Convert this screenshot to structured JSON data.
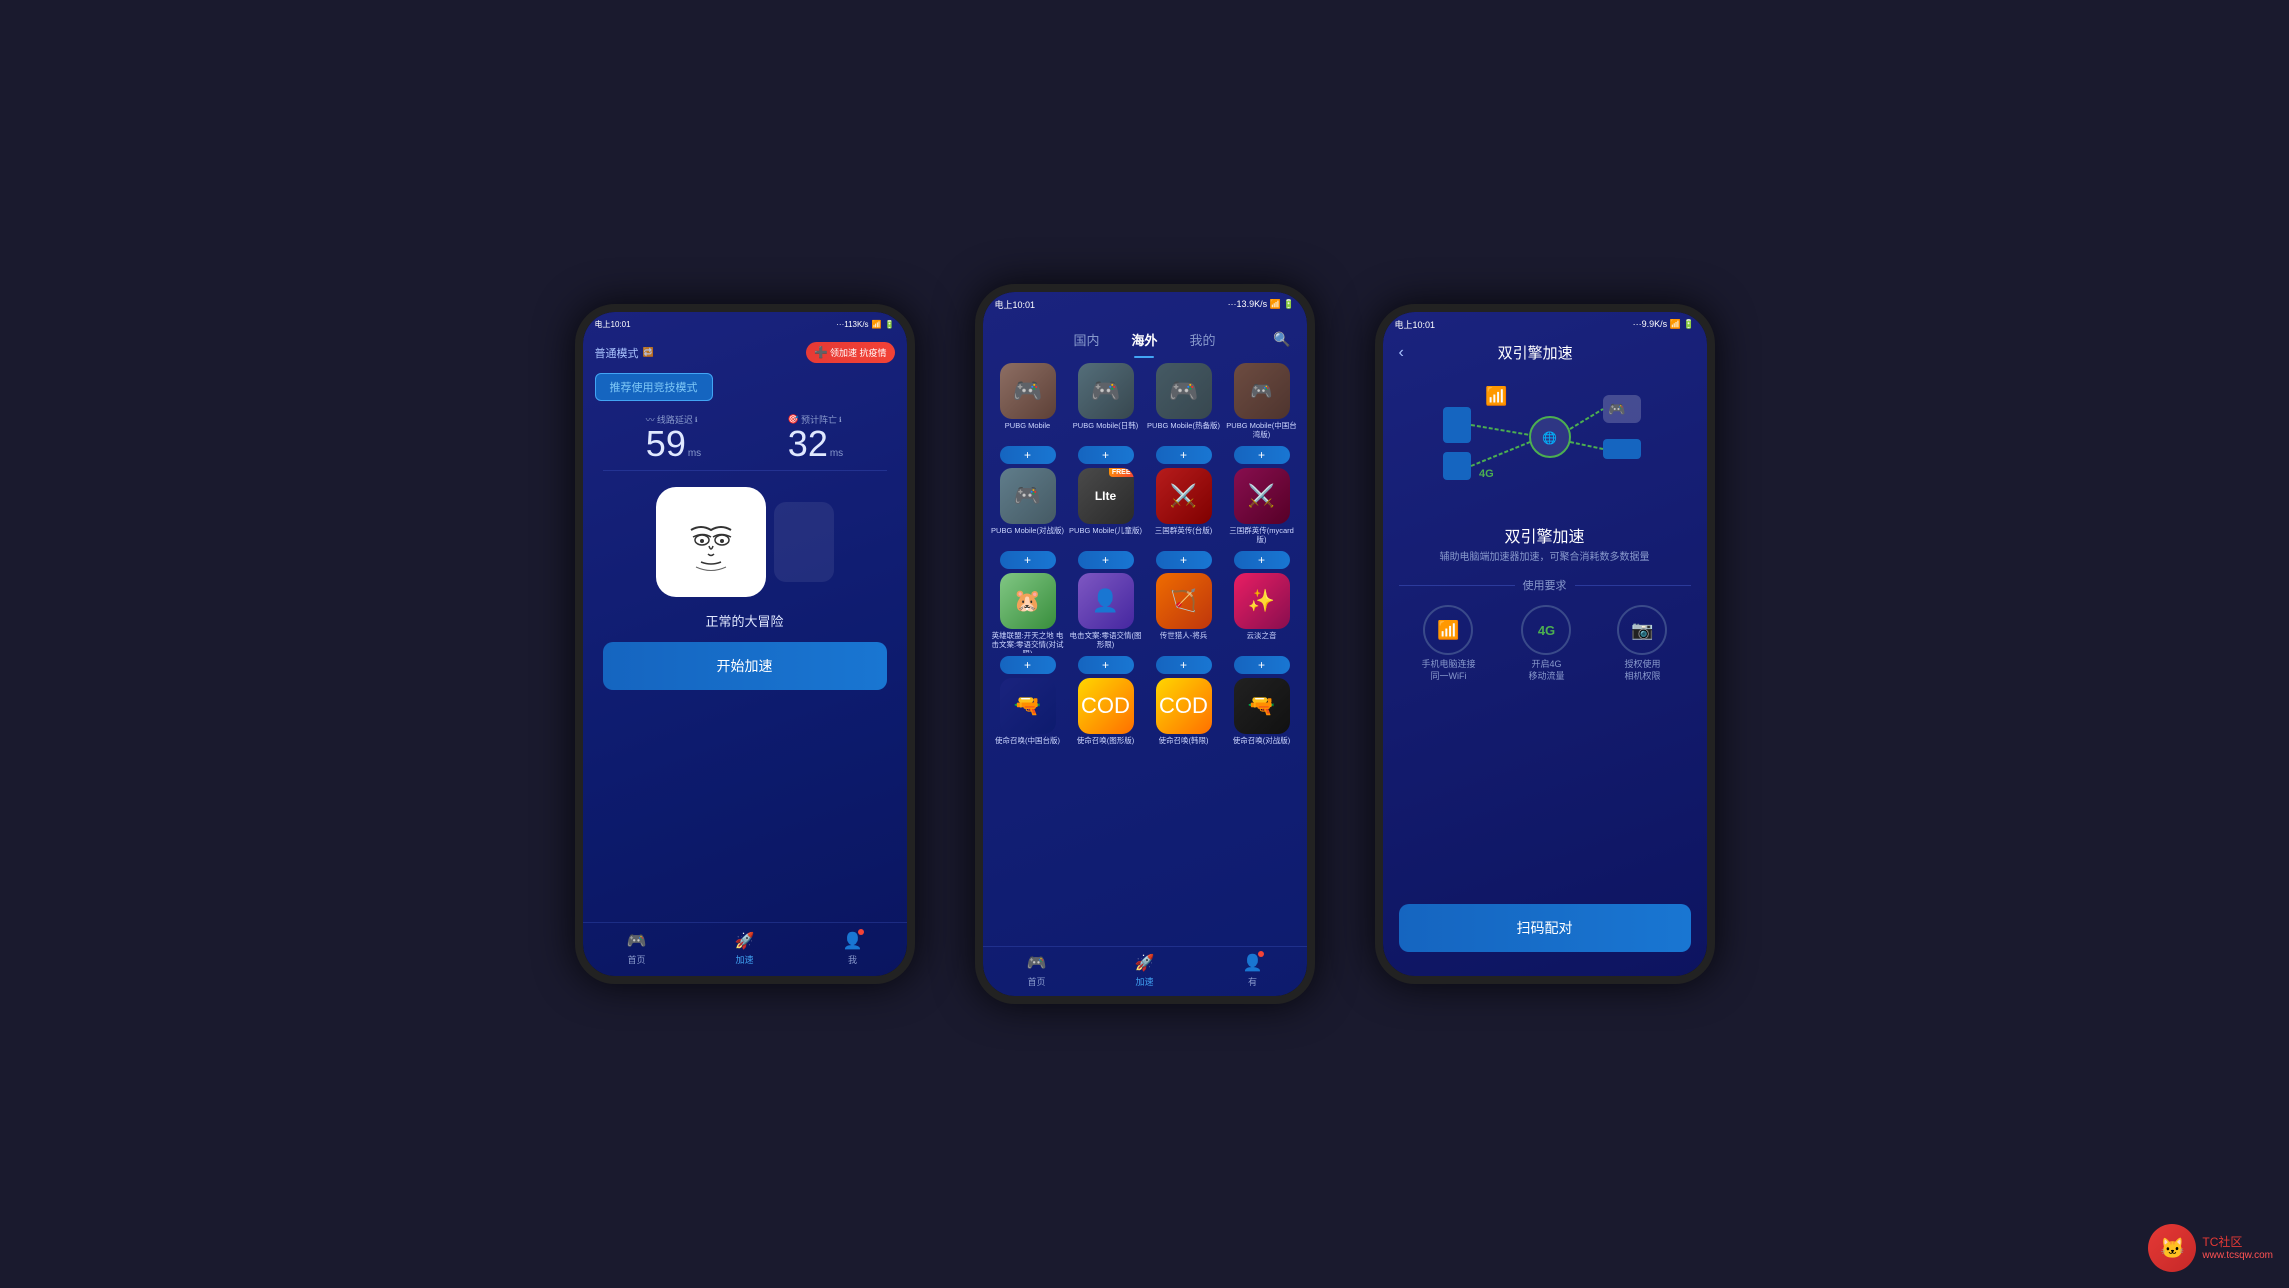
{
  "background_color": "#1a1a2e",
  "phones": [
    {
      "id": "phone1",
      "status_bar": {
        "left": "电上10:01",
        "right": "113K/s 🔋 WiFi"
      },
      "header": {
        "mode_label": "普通模式",
        "antivirus_btn": "领加速 抗疫情"
      },
      "recommend_btn": "推荐使用竞技模式",
      "stats": [
        {
          "label": "线路延迟",
          "value": "59",
          "unit": "ms"
        },
        {
          "label": "预计阵亡",
          "value": "32",
          "unit": "ms"
        }
      ],
      "game_name": "正常的大冒险",
      "start_btn": "开始加速",
      "nav": [
        {
          "label": "首页",
          "active": false
        },
        {
          "label": "加速",
          "active": true
        },
        {
          "label": "我",
          "active": false,
          "badge": true
        }
      ]
    },
    {
      "id": "phone2",
      "status_bar": {
        "left": "电上10:01",
        "right": "13.9K/s WiFi"
      },
      "tabs": [
        {
          "label": "国内",
          "active": false
        },
        {
          "label": "海外",
          "active": true
        },
        {
          "label": "我的",
          "active": false
        }
      ],
      "games": [
        [
          {
            "name": "PUBG Mobile",
            "color": "gt-pubg1",
            "emoji": "🎮"
          },
          {
            "name": "PUBG Mobile(日韩)",
            "color": "gt-pubg2",
            "emoji": "🎮"
          },
          {
            "name": "PUBG Mobile(热备版)",
            "color": "gt-pubg3",
            "emoji": "🎮"
          },
          {
            "name": "PUBG Mobile(中国台湾版)",
            "color": "gt-pubg4",
            "emoji": "🎮"
          }
        ],
        [
          {
            "name": "PUBG Mobile(对战版)",
            "color": "gt-pubg5",
            "emoji": "🎮"
          },
          {
            "name": "PUBG Mobile(儿童版)",
            "color": "gt-pubg6",
            "emoji": "LITE",
            "lite": true
          },
          {
            "name": "三国群英传(台版)",
            "color": "gt-sgz1",
            "emoji": "⚔️"
          },
          {
            "name": "三国群英传(mycard版)",
            "color": "gt-sgz2",
            "emoji": "⚔️"
          }
        ],
        [
          {
            "name": "英雄联盟:开天之地 电击文案:零语交情(对试限)",
            "color": "gt-hamster",
            "emoji": "🐹"
          },
          {
            "name": "电击文案:零语交情(图形限)",
            "color": "gt-anime",
            "emoji": "👤"
          },
          {
            "name": "传世猎人-将兵",
            "color": "gt-legend",
            "emoji": "🏹"
          },
          {
            "name": "云淡之音",
            "color": "gt-cloud",
            "emoji": "✨"
          }
        ],
        [
          {
            "name": "使命召唤(中国台版)",
            "color": "gt-fps",
            "emoji": "🔫"
          },
          {
            "name": "使命召唤(图形版)",
            "color": "gt-cod2",
            "emoji": "🔫"
          },
          {
            "name": "使命召唤(韩限)",
            "color": "gt-cod3",
            "emoji": "🔫"
          },
          {
            "name": "使命召唤(对战版)",
            "color": "gt-cod1",
            "emoji": "🔫"
          }
        ]
      ],
      "nav": [
        {
          "label": "首页",
          "active": false
        },
        {
          "label": "加速",
          "active": true
        },
        {
          "label": "有",
          "active": false,
          "badge": true
        }
      ]
    },
    {
      "id": "phone3",
      "status_bar": {
        "left": "电上10:01",
        "right": "9.9K/s WiFi"
      },
      "back_label": "‹",
      "title": "双引擎加速",
      "feature_title": "双引擎加速",
      "feature_desc": "辅助电脑端加速器加速，可聚合消耗数多数据量",
      "requirements_label": "使用要求",
      "req_items": [
        {
          "icon": "📱",
          "label": "手机电脑连接\n同一WiFi"
        },
        {
          "icon": "4G",
          "label": "开启4G\n移动流量"
        },
        {
          "icon": "📷",
          "label": "授权使用\n相机权限"
        }
      ],
      "scan_btn": "扫码配对"
    }
  ],
  "watermark": {
    "site": "TC社区",
    "url": "www.tcsqw.com"
  }
}
